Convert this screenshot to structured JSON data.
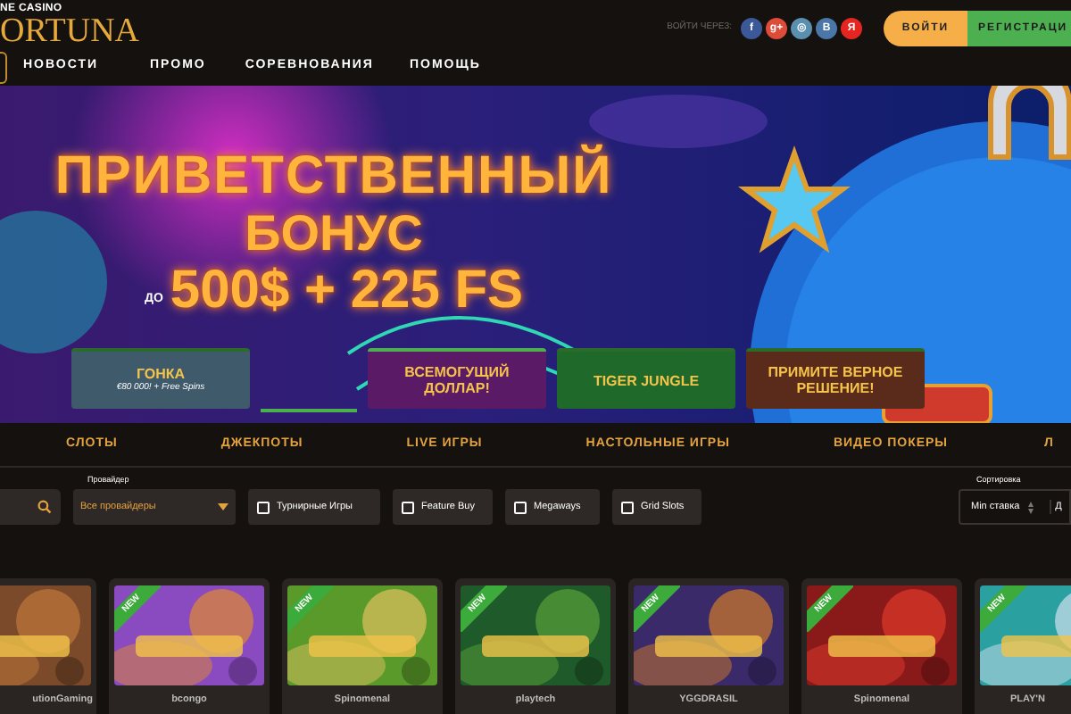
{
  "header": {
    "logo_tagline": "NE CASINO",
    "logo": "ORTUNA",
    "nav": [
      {
        "label": "НОВОСТИ"
      },
      {
        "label": "ПРОМО"
      },
      {
        "label": "СОРЕВНОВАНИЯ"
      },
      {
        "label": "ПОМОЩЬ"
      }
    ],
    "social_label": "ВОЙТИ ЧЕРЕЗ:",
    "social": [
      {
        "glyph": "f",
        "color": "#3b5998"
      },
      {
        "glyph": "g+",
        "color": "#dd4b39"
      },
      {
        "glyph": "◎",
        "color": "#5a8fb0"
      },
      {
        "glyph": "В",
        "color": "#4a76a8"
      },
      {
        "glyph": "Я",
        "color": "#e52620"
      }
    ],
    "login": "ВОЙТИ",
    "register": "РЕГИСТРАЦИ"
  },
  "banner": {
    "title": "ПРИВЕТСТВЕННЫЙ",
    "subtitle": "БОНУС",
    "prefix": "ДО",
    "amount": "500$ + 225 FS",
    "promos": [
      {
        "title": "ГОНКА",
        "note": "€80 000! + Free Spins",
        "selected": false
      },
      {
        "title": "ВСЕМОГУЩИЙ ДОЛЛАР!",
        "selected": true
      },
      {
        "title": "TIGER JUNGLE",
        "selected": false
      },
      {
        "title": "ПРИМИТЕ ВЕРНОЕ РЕШЕНИЕ!",
        "selected": false
      }
    ]
  },
  "categories": [
    {
      "label": "СЛОТЫ"
    },
    {
      "label": "ДЖЕКПОТЫ"
    },
    {
      "label": "LIVE ИГРЫ"
    },
    {
      "label": "НАСТОЛЬНЫЕ ИГРЫ"
    },
    {
      "label": "ВИДЕО ПОКЕРЫ"
    },
    {
      "label": "Л"
    }
  ],
  "filters": {
    "provider_label": "Провайдер",
    "provider_value": "Все провайдеры",
    "checkboxes": [
      {
        "label": "Турнирные Игры",
        "checked": false
      },
      {
        "label": "Feature Buy",
        "checked": false
      },
      {
        "label": "Megaways",
        "checked": false
      },
      {
        "label": "Grid Slots",
        "checked": false
      }
    ],
    "sort_label": "Сортировка",
    "sort_value": "Min ставка",
    "sort_value_2": "Д"
  },
  "games": [
    {
      "provider": "utionGaming"
    },
    {
      "provider": "bcongo",
      "badge": "NEW"
    },
    {
      "provider": "Spinomenal",
      "badge": "NEW"
    },
    {
      "provider": "playtech",
      "badge": "NEW"
    },
    {
      "provider": "YGGDRASIL",
      "badge": "NEW"
    },
    {
      "provider": "Spinomenal",
      "badge": "NEW"
    },
    {
      "provider": "PLAY'N",
      "badge": "NEW"
    }
  ]
}
